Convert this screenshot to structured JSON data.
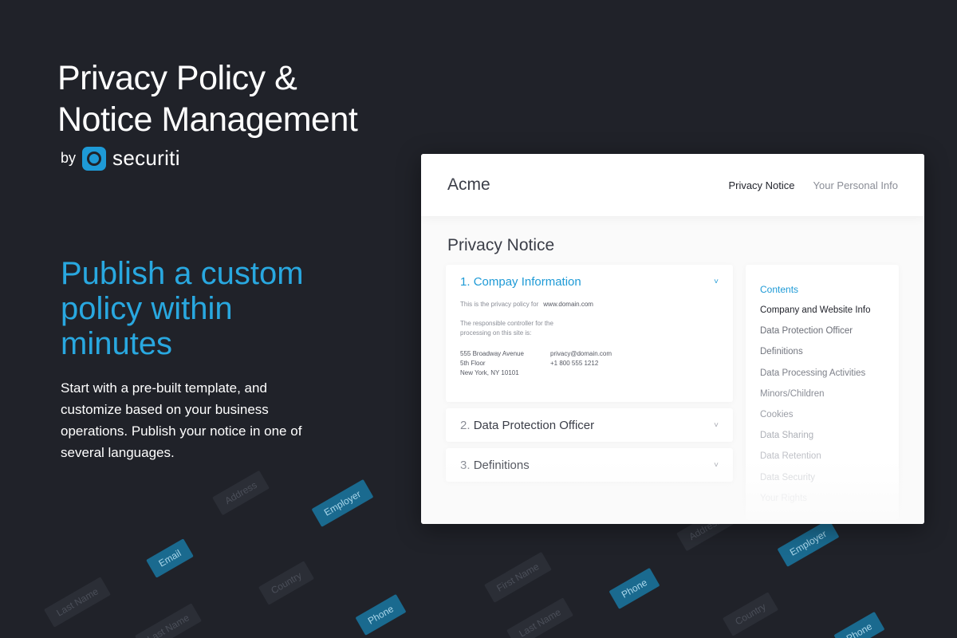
{
  "hero": {
    "headline_line1": "Privacy Policy &",
    "headline_line2": "Notice Management",
    "by_label": "by",
    "brand_name": "securiti",
    "tagline_line1": "Publish a custom",
    "tagline_line2": "policy within",
    "tagline_line3": "minutes",
    "description": "Start with a pre-built template, and customize based on your business operations. Publish your notice in one of several languages."
  },
  "colors": {
    "background": "#202229",
    "accent": "#1e9ad6",
    "tagline": "#29a8e0"
  },
  "background_tags": [
    "Address",
    "Employer",
    "Email",
    "Country",
    "Last Name",
    "First Name",
    "Phone",
    "Phone",
    "Last Name",
    "Country",
    "Employer",
    "Last Name",
    "Phone",
    "Address"
  ],
  "card": {
    "brand": "Acme",
    "nav": [
      "Privacy Notice",
      "Your Personal Info"
    ],
    "active_nav": "Privacy Notice",
    "title": "Privacy Notice",
    "sections": [
      {
        "number": "1.",
        "title": "Compay Information",
        "expanded": true
      },
      {
        "number": "2.",
        "title": "Data Protection Officer",
        "expanded": false
      },
      {
        "number": "3.",
        "title": "Definitions",
        "expanded": false
      }
    ],
    "section1_body": {
      "policy_label": "This is the privacy policy for",
      "policy_domain": "www.domain.com",
      "controller_text": "The responsible controller for the processing on this site is:",
      "address_line1": "555 Broadway Avenue",
      "address_line2": "5th Floor",
      "address_line3": "New York, NY 10101",
      "email": "privacy@domain.com",
      "phone": "+1 800 555 1212"
    },
    "toc": {
      "heading": "Contents",
      "items": [
        "Company and Website Info",
        "Data Protection Officer",
        "Definitions",
        "Data Processing Activities",
        "Minors/Children",
        "Cookies",
        "Data Sharing",
        "Data Retention",
        "Data Security",
        "Your Rights"
      ]
    }
  }
}
